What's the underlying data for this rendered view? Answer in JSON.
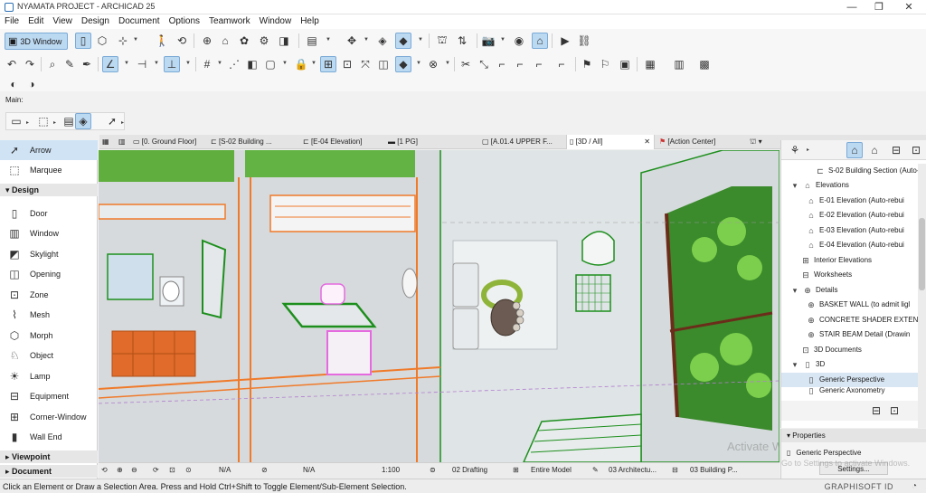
{
  "window": {
    "title": "NYAMATA PROJECT - ARCHICAD 25",
    "minimize": "—",
    "maximize": "❐",
    "close": "✕"
  },
  "menu": [
    "File",
    "Edit",
    "View",
    "Design",
    "Document",
    "Options",
    "Teamwork",
    "Window",
    "Help"
  ],
  "toolbar1": {
    "view_3d_label": "3D Window"
  },
  "main_label": "Main:",
  "tabs": [
    {
      "label": "[0. Ground Floor]",
      "icon": "floorplan-icon"
    },
    {
      "label": "[S-02 Building ...",
      "icon": "section-icon"
    },
    {
      "label": "[E-04 Elevation]",
      "icon": "elevation-icon"
    },
    {
      "label": "[1 PG]",
      "icon": "layout-icon"
    },
    {
      "label": "[A.01.4 UPPER F...",
      "icon": "detail-icon"
    },
    {
      "label": "[3D / All]",
      "icon": "3d-icon",
      "close": "✕"
    },
    {
      "label": "[Action Center]",
      "icon": "action-center-icon"
    }
  ],
  "toolbox": {
    "tools_top": [
      {
        "label": "Arrow",
        "icon": "arrow-icon",
        "selected": true
      },
      {
        "label": "Marquee",
        "icon": "marquee-icon"
      }
    ],
    "design_section": "Design",
    "design_tools": [
      {
        "label": "Door",
        "icon": "door-icon"
      },
      {
        "label": "Window",
        "icon": "window-icon"
      },
      {
        "label": "Skylight",
        "icon": "skylight-icon"
      },
      {
        "label": "Opening",
        "icon": "opening-icon"
      },
      {
        "label": "Zone",
        "icon": "zone-icon"
      },
      {
        "label": "Mesh",
        "icon": "mesh-icon"
      },
      {
        "label": "Morph",
        "icon": "morph-icon"
      },
      {
        "label": "Object",
        "icon": "object-icon"
      },
      {
        "label": "Lamp",
        "icon": "lamp-icon"
      },
      {
        "label": "Equipment",
        "icon": "equipment-icon"
      },
      {
        "label": "Corner-Window",
        "icon": "corner-window-icon"
      },
      {
        "label": "Wall End",
        "icon": "wall-end-icon"
      }
    ],
    "viewpoint_section": "Viewpoint",
    "document_section": "Document"
  },
  "navigator": {
    "items": [
      {
        "label": "S-02 Building Section (Auto-",
        "indent": 3,
        "icon": "section-icon"
      },
      {
        "label": "Elevations",
        "indent": 1,
        "icon": "folder-icon",
        "expanded": true
      },
      {
        "label": "E-01 Elevation (Auto-rebui",
        "indent": 2,
        "icon": "elevation-icon"
      },
      {
        "label": "E-02 Elevation (Auto-rebui",
        "indent": 2,
        "icon": "elevation-icon"
      },
      {
        "label": "E-03 Elevation (Auto-rebui",
        "indent": 2,
        "icon": "elevation-icon"
      },
      {
        "label": "E-04 Elevation (Auto-rebui",
        "indent": 2,
        "icon": "elevation-icon"
      },
      {
        "label": "Interior Elevations",
        "indent": 1,
        "icon": "interior-elevation-icon"
      },
      {
        "label": "Worksheets",
        "indent": 1,
        "icon": "worksheet-icon"
      },
      {
        "label": "Details",
        "indent": 1,
        "icon": "folder-icon",
        "expanded": true
      },
      {
        "label": "BASKET WALL (to admit ligl",
        "indent": 2,
        "icon": "detail-icon"
      },
      {
        "label": "CONCRETE SHADER EXTEN",
        "indent": 2,
        "icon": "detail-icon"
      },
      {
        "label": "STAIR BEAM Detail (Drawin",
        "indent": 2,
        "icon": "detail-icon"
      },
      {
        "label": "3D Documents",
        "indent": 1,
        "icon": "3d-document-icon"
      },
      {
        "label": "3D",
        "indent": 1,
        "icon": "folder-icon",
        "expanded": true
      },
      {
        "label": "Generic Perspective",
        "indent": 2,
        "icon": "perspective-icon",
        "selected": true
      },
      {
        "label": "Generic Axonometry",
        "indent": 2,
        "icon": "axonometry-icon"
      }
    ]
  },
  "properties": {
    "header": "Properties",
    "view_name": "Generic Perspective",
    "settings_button": "Settings..."
  },
  "viewbar": {
    "zoom_na": "N/A",
    "angle_na": "N/A",
    "scale": "1:100",
    "layer": "02 Drafting",
    "model": "Entire Model",
    "pen_set": "03 Architectu...",
    "model_view": "03 Building P..."
  },
  "status": {
    "message": "Click an Element or Draw a Selection Area. Press and Hold Ctrl+Shift to Toggle Element/Sub-Element Selection.",
    "brand": "GRAPHISOFT ID"
  },
  "watermark": {
    "line1": "Activate Windows",
    "line2": "Go to Settings to activate Windows."
  },
  "colors": {
    "accent": "#bcd9f2",
    "selection": "#cfe3f5",
    "plant_green": "#3aa83a",
    "highlight_orange": "#f07a2a",
    "model_green_outline": "#1d8f1d"
  }
}
